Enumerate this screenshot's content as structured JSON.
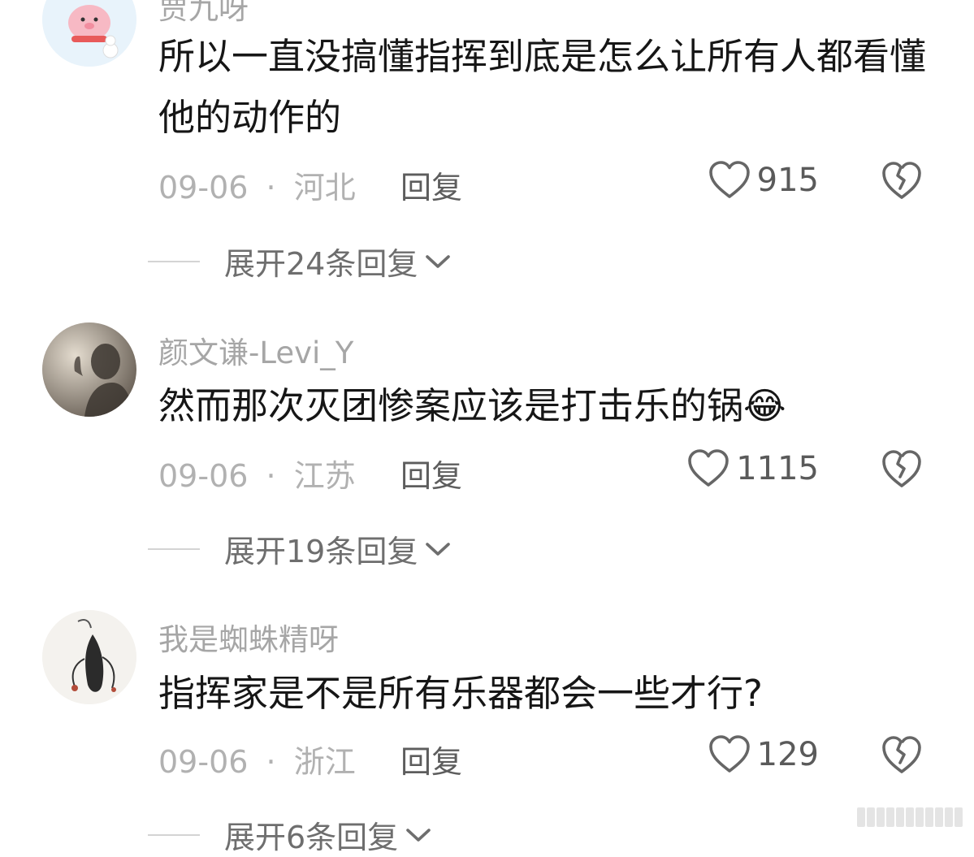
{
  "comments": [
    {
      "username": "贾九呀",
      "text": "所以一直没搞懂指挥到底是怎么让所有人都看懂他的动作的",
      "date": "09-06",
      "separator": "·",
      "location": "河北",
      "reply_label": "回复",
      "likes": "915",
      "expand_label": "展开24条回复"
    },
    {
      "username": "颜文谦-Levi_Y",
      "text": "然而那次灭团惨案应该是打击乐的锅",
      "emoji": "😂",
      "date": "09-06",
      "separator": "·",
      "location": "江苏",
      "reply_label": "回复",
      "likes": "1115",
      "expand_label": "展开19条回复"
    },
    {
      "username": "我是蜘蛛精呀",
      "text": "指挥家是不是所有乐器都会一些才行?",
      "date": "09-06",
      "separator": "·",
      "location": "浙江",
      "reply_label": "回复",
      "likes": "129",
      "expand_label": "展开6条回复"
    }
  ],
  "colors": {
    "text": "#161616",
    "username": "#a6a6a6",
    "meta": "#b1b1b1",
    "icon": "#666666"
  },
  "icons": {
    "like": "heart-outline-icon",
    "dislike": "broken-heart-icon",
    "expand": "chevron-down-icon"
  }
}
